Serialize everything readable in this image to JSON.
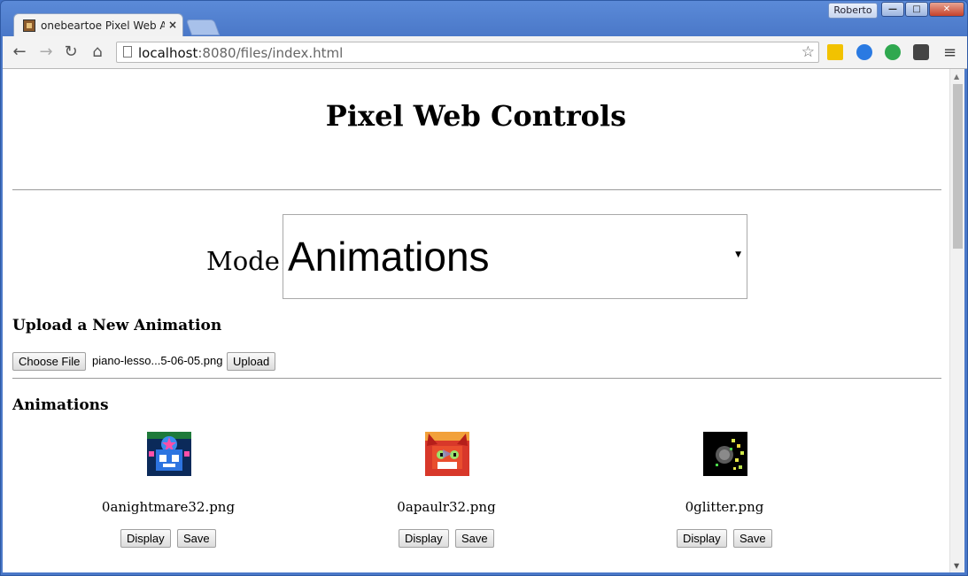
{
  "browser": {
    "tab_title": "onebeartoe Pixel Web App",
    "tab_close": "×",
    "user": "Roberto",
    "url_host": "localhost",
    "url_path": ":8080/files/index.html",
    "window_buttons": {
      "minimize": "—",
      "maximize": "□",
      "close": "✕"
    },
    "nav": {
      "back": "←",
      "forward": "→",
      "reload": "↻",
      "home": "⌂"
    },
    "star": "☆",
    "menu": "≡"
  },
  "page": {
    "title": "Pixel Web Controls",
    "mode_label": "Mode:",
    "mode_value": "Animations",
    "upload": {
      "heading": "Upload a New Animation",
      "choose_button": "Choose File",
      "file_name": "piano-lesso...5-06-05.png",
      "upload_button": "Upload"
    },
    "animations": {
      "heading": "Animations",
      "items": [
        {
          "file": "0anightmare32.png",
          "display": "Display",
          "save": "Save"
        },
        {
          "file": "0apaulr32.png",
          "display": "Display",
          "save": "Save"
        },
        {
          "file": "0glitter.png",
          "display": "Display",
          "save": "Save"
        }
      ]
    }
  },
  "colors": {
    "chrome_blue": "#4a78c8",
    "page_bg": "#ffffff",
    "rule": "#9a9a9a"
  }
}
